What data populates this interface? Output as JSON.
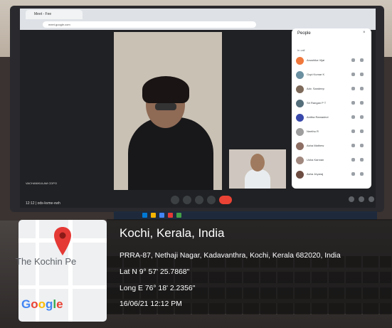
{
  "browser": {
    "tab_title": "Meet - Fee",
    "address": "meet.google.com"
  },
  "meet": {
    "self_name": "VACHANIKULAM CDPO",
    "time_code": "12:12  | ods-kvme-vwh"
  },
  "people_panel": {
    "title": "People",
    "close": "×",
    "section": "In call",
    "participants": [
      {
        "name": "Anushika Vijai",
        "color": "#f0783c"
      },
      {
        "name": "Gopi Kumar K",
        "color": "#6a8fa0"
      },
      {
        "name": "Adv. Sandeep",
        "color": "#7e6a5a"
      },
      {
        "name": "Sri Rangan P T",
        "color": "#546e7a"
      },
      {
        "name": "Anitha Ramadevi",
        "color": "#3949ab"
      },
      {
        "name": "Neethu R",
        "color": "#9e9e9e"
      },
      {
        "name": "Asha Mathew",
        "color": "#8d6e63"
      },
      {
        "name": "Usha Kannan",
        "color": "#a1887f"
      },
      {
        "name": "Asha Jeyaraj",
        "color": "#6d4c41"
      }
    ]
  },
  "overlay": {
    "location": "Kochi, Kerala, India",
    "address": "PRRA-87, Nethaji Nagar, Kadavanthra, Kochi, Kerala 682020, India",
    "latitude": "Lat N 9° 57' 25.7868\"",
    "longitude": "Long E 76° 18' 2.2356\"",
    "datetime": "16/06/21 12:12 PM"
  },
  "map": {
    "place_label": "The Kochin Pe",
    "logo_text": "Google",
    "pin_color": "#e53935"
  }
}
